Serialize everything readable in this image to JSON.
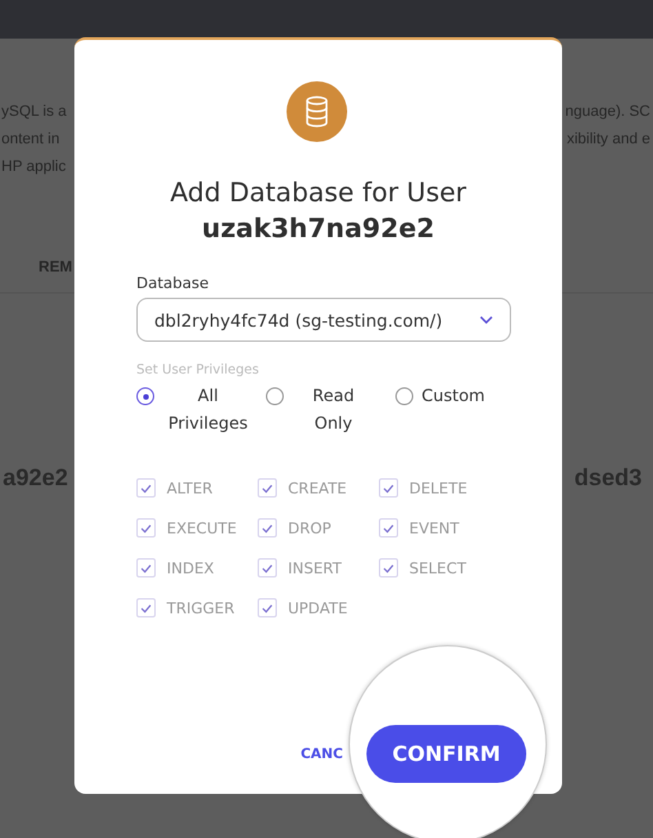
{
  "background_page": {
    "paragraph_lines": [
      {
        "left": "ySQL is a",
        "right": "nguage). SC"
      },
      {
        "left": "ontent in",
        "right": "xibility and e"
      },
      {
        "left": "HP applic"
      }
    ],
    "tab": "REM",
    "row_names": {
      "left": "a92e2",
      "right": "dsed3"
    }
  },
  "dialog": {
    "title": "Add Database for User",
    "user": "uzak3h7na92e2",
    "database_label": "Database",
    "database_value": "dbl2ryhy4fc74d (sg-testing.com/)",
    "privileges_label": "Set User Privileges",
    "privilege_options": [
      {
        "label": "All Privileges",
        "selected": true
      },
      {
        "label": "Read Only",
        "selected": false
      },
      {
        "label": "Custom",
        "selected": false
      }
    ],
    "permissions": [
      {
        "label": "ALTER",
        "checked": true
      },
      {
        "label": "CREATE",
        "checked": true
      },
      {
        "label": "DELETE",
        "checked": true
      },
      {
        "label": "EXECUTE",
        "checked": true
      },
      {
        "label": "DROP",
        "checked": true
      },
      {
        "label": "EVENT",
        "checked": true
      },
      {
        "label": "INDEX",
        "checked": true
      },
      {
        "label": "INSERT",
        "checked": true
      },
      {
        "label": "SELECT",
        "checked": true
      },
      {
        "label": "TRIGGER",
        "checked": true
      },
      {
        "label": "UPDATE",
        "checked": true
      }
    ],
    "cancel_label": "CANC",
    "confirm_label": "CONFIRM"
  }
}
